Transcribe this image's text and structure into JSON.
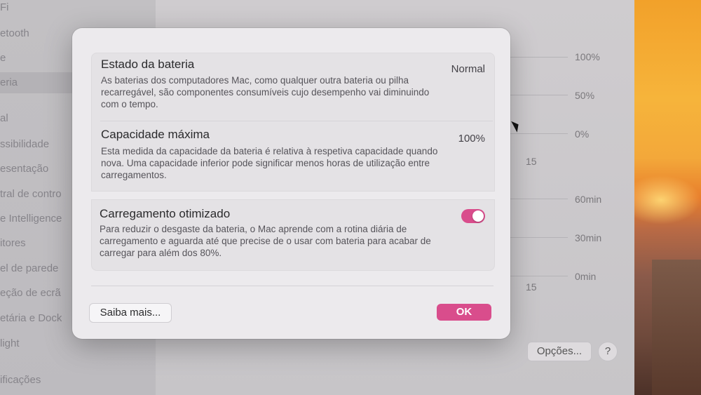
{
  "sidebar": {
    "items": [
      {
        "label": "Fi"
      },
      {
        "label": "etooth"
      },
      {
        "label": "e"
      },
      {
        "label": "eria"
      },
      {
        "label": "al"
      },
      {
        "label": "ssibilidade"
      },
      {
        "label": "esentação"
      },
      {
        "label": "tral de contro"
      },
      {
        "label": "e Intelligence"
      },
      {
        "label": "itores"
      },
      {
        "label": "el de parede"
      },
      {
        "label": "eção de ecrã"
      },
      {
        "label": "etária e Dock"
      },
      {
        "label": "light"
      },
      {
        "label": "ificações"
      }
    ]
  },
  "background_chart": {
    "y_top": [
      "100%",
      "50%",
      "0%"
    ],
    "x_top": "15",
    "y_bottom": [
      "60min",
      "30min",
      "0min"
    ],
    "x_bottom": "15"
  },
  "footer": {
    "options_label": "Opções...",
    "help_label": "?"
  },
  "dialog": {
    "battery_state": {
      "title": "Estado da bateria",
      "description": "As baterias dos computadores Mac, como qualquer outra bateria ou pilha recarregável, são componentes consumíveis cujo desempenho vai diminuindo com o tempo.",
      "value": "Normal"
    },
    "max_capacity": {
      "title": "Capacidade máxima",
      "description": "Esta medida da capacidade da bateria é relativa à respetiva capacidade quando nova. Uma capacidade inferior pode significar menos horas de utilização entre carregamentos.",
      "value": "100%"
    },
    "optimized_charging": {
      "title": "Carregamento otimizado",
      "description": "Para reduzir o desgaste da bateria, o Mac aprende com a rotina diária de carregamento e aguarda até que precise de o usar com bateria para acabar de carregar para além dos 80%.",
      "enabled": true
    },
    "learn_more_label": "Saiba mais...",
    "ok_label": "OK"
  },
  "colors": {
    "accent": "#d94d8c"
  }
}
